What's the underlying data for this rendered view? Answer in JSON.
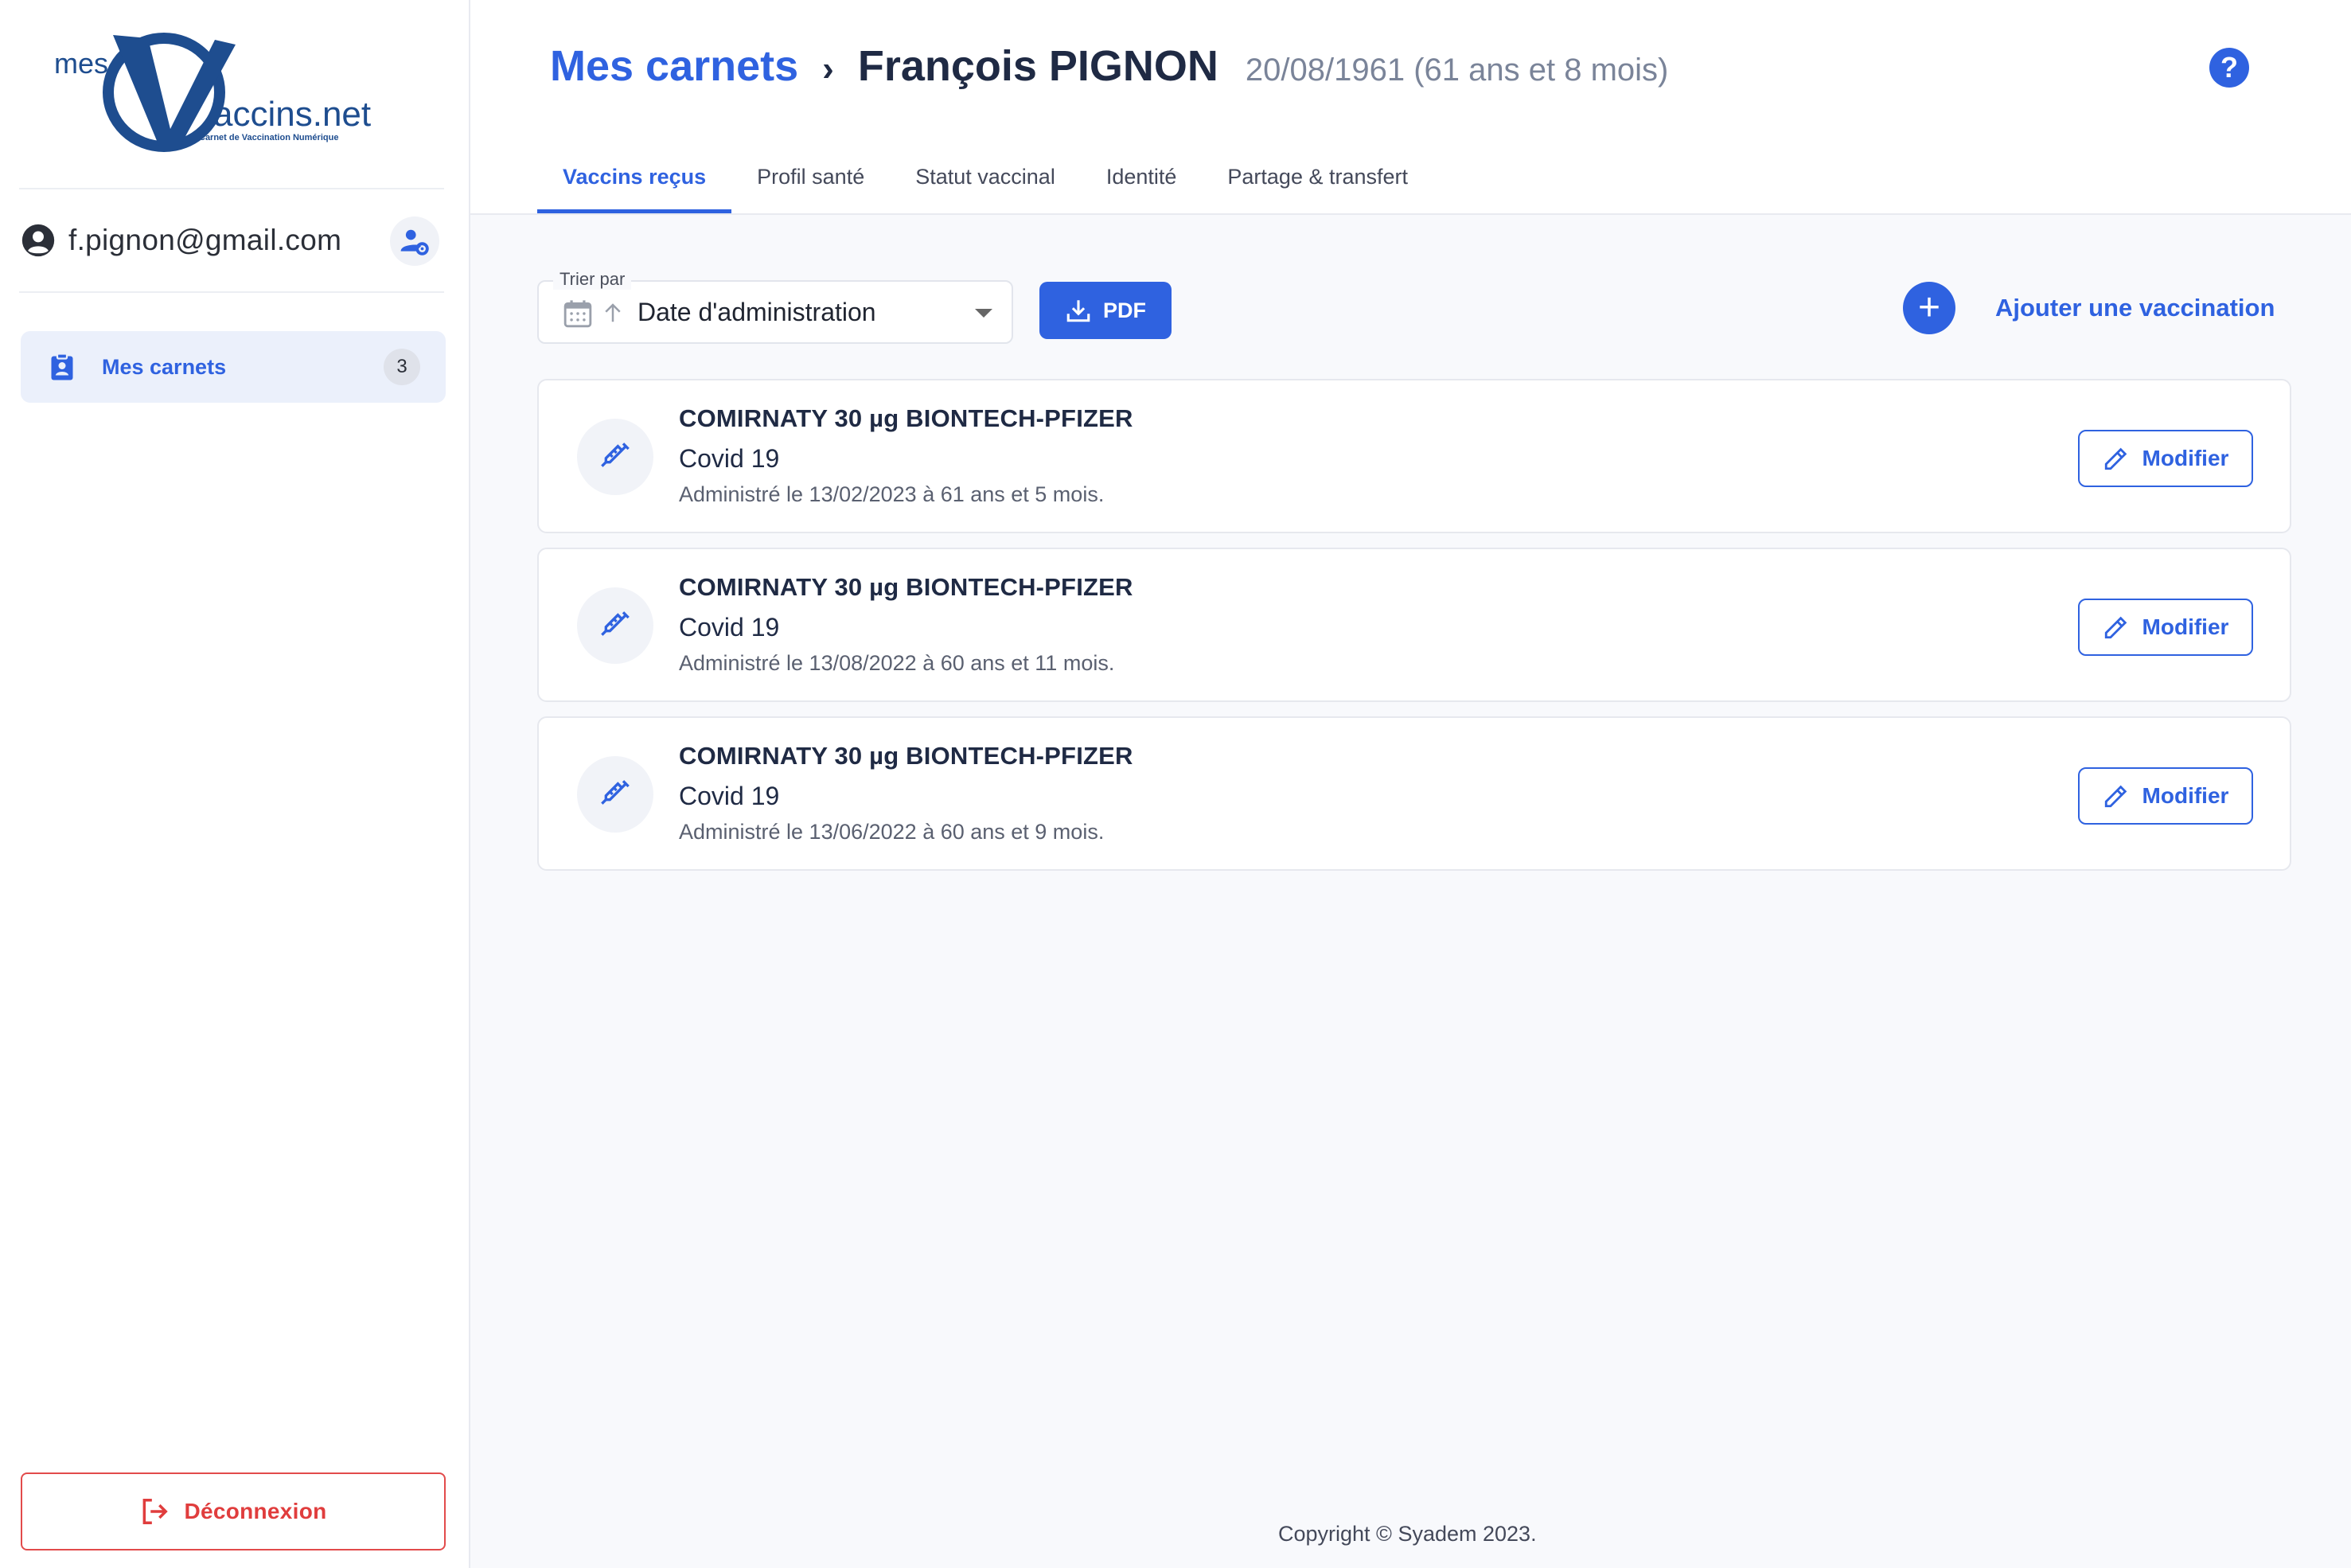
{
  "logo": {
    "prefix": "mes",
    "brand_rest": "accins.net",
    "tagline": "Carnet de Vaccination Numérique"
  },
  "user": {
    "email": "f.pignon@gmail.com"
  },
  "sidebar": {
    "items": [
      {
        "label": "Mes carnets",
        "count": "3"
      }
    ],
    "logout_label": "Déconnexion"
  },
  "header": {
    "breadcrumb_root": "Mes carnets",
    "breadcrumb_separator": "›",
    "person_name": "François PIGNON",
    "birth_info": "20/08/1961 (61 ans et 8 mois)",
    "help_label": "?"
  },
  "tabs": [
    {
      "label": "Vaccins reçus",
      "active": true
    },
    {
      "label": "Profil santé"
    },
    {
      "label": "Statut vaccinal"
    },
    {
      "label": "Identité"
    },
    {
      "label": "Partage & transfert"
    }
  ],
  "toolbar": {
    "sort_label": "Trier par",
    "sort_value": "Date d'administration",
    "pdf_label": "PDF",
    "add_label": "Ajouter une vaccination",
    "add_symbol": "+"
  },
  "vaccinations": [
    {
      "name": "COMIRNATY 30 µg BIONTECH-PFIZER",
      "disease": "Covid 19",
      "administered": "Administré le 13/02/2023 à 61 ans et 5 mois.",
      "edit_label": "Modifier"
    },
    {
      "name": "COMIRNATY 30 µg BIONTECH-PFIZER",
      "disease": "Covid 19",
      "administered": "Administré le 13/08/2022 à 60 ans et 11 mois.",
      "edit_label": "Modifier"
    },
    {
      "name": "COMIRNATY 30 µg BIONTECH-PFIZER",
      "disease": "Covid 19",
      "administered": "Administré le 13/06/2022 à 60 ans et 9 mois.",
      "edit_label": "Modifier"
    }
  ],
  "footer": {
    "copyright": "Copyright © Syadem 2023."
  },
  "colors": {
    "accent": "#2f62e0",
    "danger": "#e03d3d",
    "brand": "#1e4d8f"
  }
}
